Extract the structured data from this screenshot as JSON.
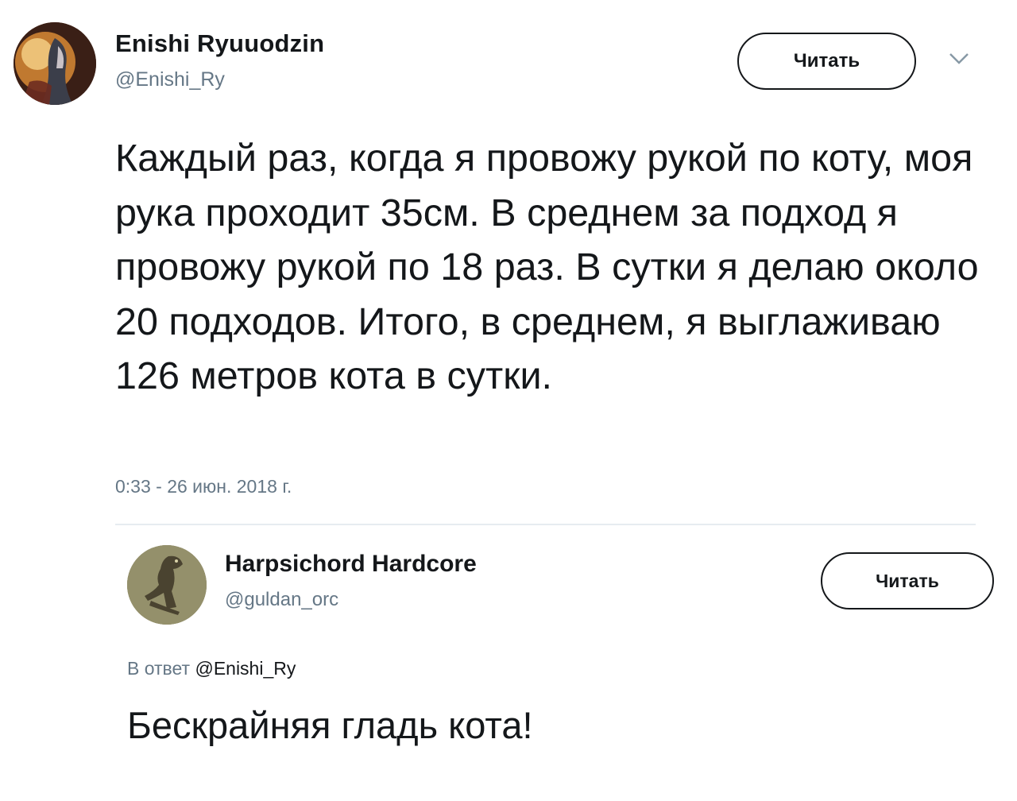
{
  "tweet": {
    "author_name": "Enishi Ryuuodzin",
    "author_handle": "@Enishi_Ry",
    "follow_label": "Читать",
    "text": "Каждый раз, когда я провожу рукой по коту, моя рука проходит 35см. В среднем за подход я провожу рукой по 18 раз. В сутки я делаю около 20 подходов. Итого, в среднем, я выглаживаю 126 метров кота в сутки.",
    "timestamp": "0:33 - 26 июн. 2018 г."
  },
  "reply": {
    "author_name": "Harpsichord Hardcore",
    "author_handle": "@guldan_orc",
    "follow_label": "Читать",
    "reply_prefix": "В ответ",
    "reply_to": "@Enishi_Ry",
    "text": "Бескрайняя гладь кота!"
  },
  "icons": {
    "menu": "chevron-down-icon"
  },
  "colors": {
    "text": "#14171a",
    "secondary": "#657786",
    "divider": "#e6ecf0"
  }
}
